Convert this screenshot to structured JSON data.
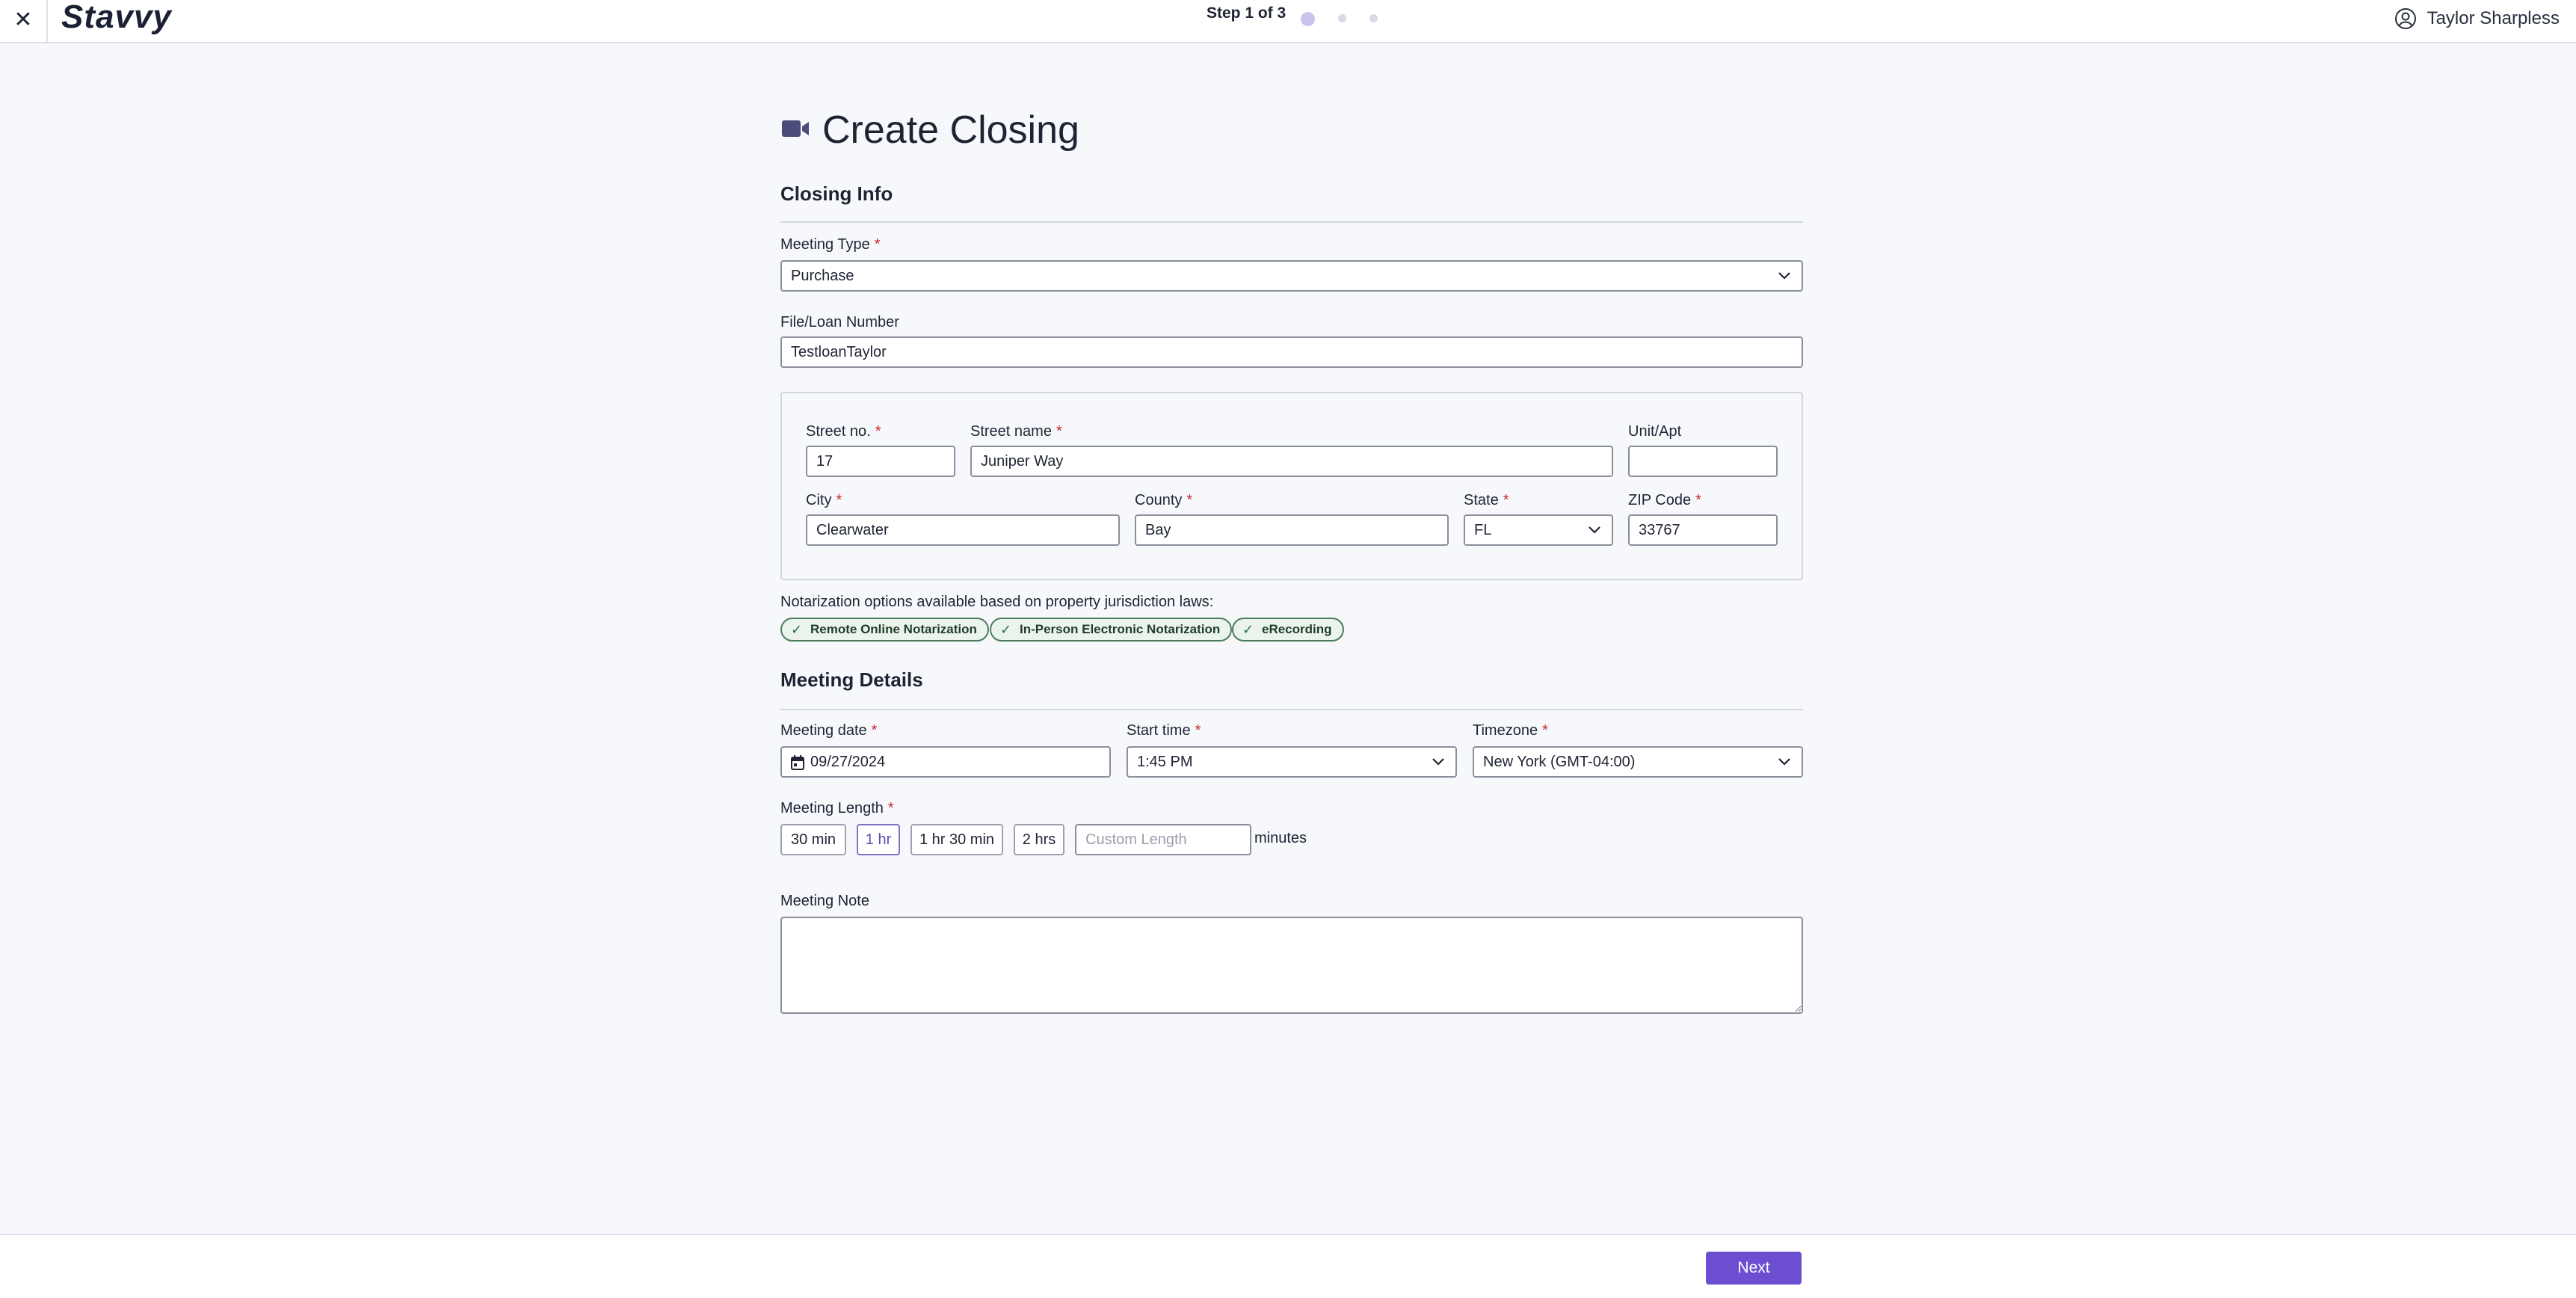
{
  "header": {
    "close_glyph": "✕",
    "logo": "Stavvy",
    "step": "Step 1 of 3",
    "user_name": "Taylor Sharpless"
  },
  "page": {
    "title": "Create Closing",
    "icon": "video-camera-icon"
  },
  "closing_info": {
    "section_title": "Closing Info",
    "meeting_type": {
      "label": "Meeting Type",
      "value": "Purchase"
    },
    "file_loan": {
      "label": "File/Loan Number",
      "value": "TestloanTaylor"
    },
    "address": {
      "street_no": {
        "label": "Street no.",
        "value": "17"
      },
      "street_name": {
        "label": "Street name",
        "value": "Juniper Way"
      },
      "unit": {
        "label": "Unit/Apt",
        "value": ""
      },
      "city": {
        "label": "City",
        "value": "Clearwater"
      },
      "county": {
        "label": "County",
        "value": "Bay"
      },
      "state": {
        "label": "State",
        "value": "FL"
      },
      "zip": {
        "label": "ZIP Code",
        "value": "33767"
      }
    },
    "notarization_text": "Notarization options available based on property jurisdiction laws:",
    "badges": [
      "Remote Online Notarization",
      "In-Person Electronic Notarization",
      "eRecording"
    ]
  },
  "meeting_details": {
    "section_title": "Meeting Details",
    "date": {
      "label": "Meeting date",
      "value": "09/27/2024"
    },
    "start_time": {
      "label": "Start time",
      "value": "1:45 PM"
    },
    "timezone": {
      "label": "Timezone",
      "value": "New York (GMT-04:00)"
    },
    "length": {
      "label": "Meeting Length",
      "options": [
        "30 min",
        "1 hr",
        "1 hr 30 min",
        "2 hrs"
      ],
      "selected": "1 hr",
      "custom_placeholder": "Custom Length",
      "unit": "minutes"
    },
    "note": {
      "label": "Meeting Note",
      "value": ""
    }
  },
  "footer": {
    "next_label": "Next"
  },
  "colors": {
    "accent": "#6c4fd0",
    "badge_border": "#4d7c5a",
    "required": "#c62828"
  }
}
